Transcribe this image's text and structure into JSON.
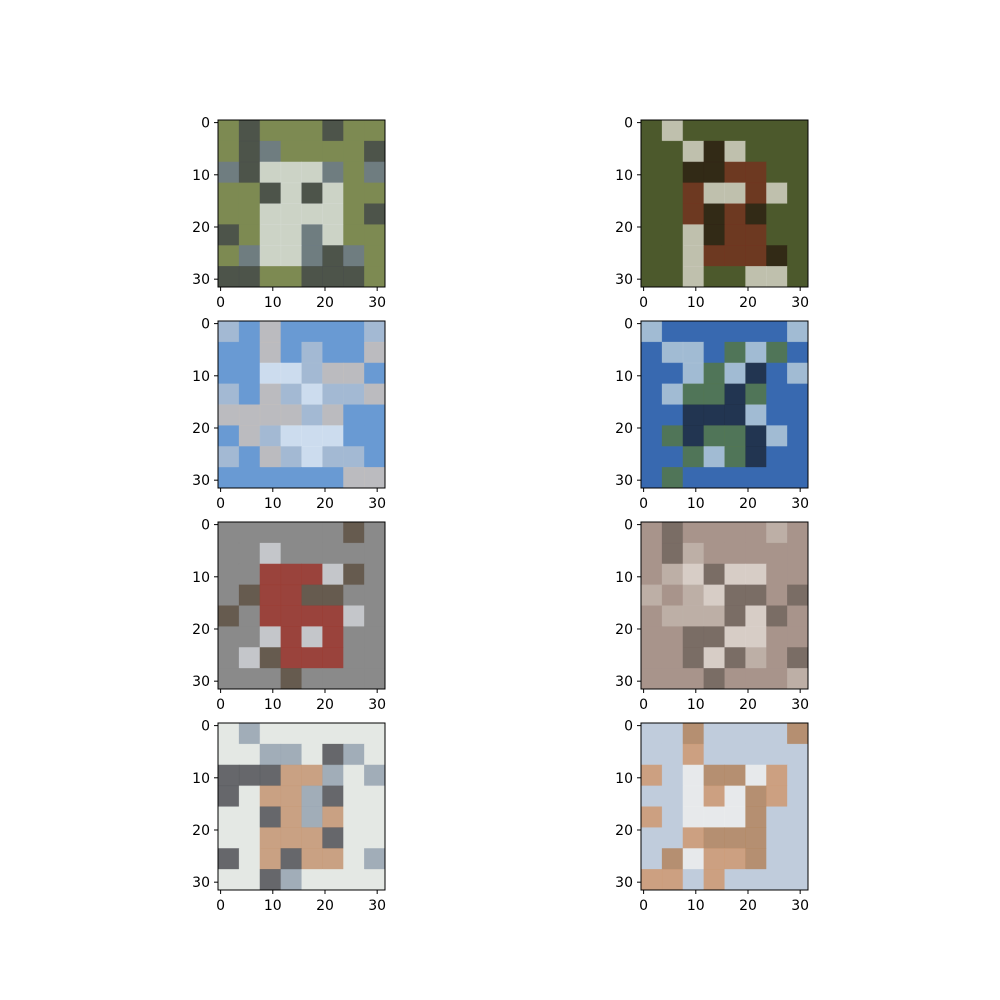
{
  "figure": {
    "subplots": [
      {
        "row": 0,
        "col": 0,
        "content": "blurry 32x32 photo: grey-white vehicle on green background",
        "colors": {
          "bg": "#7d8a52",
          "main": "#e8ecf0",
          "dark": "#3c4048",
          "accent": "#6a7890"
        }
      },
      {
        "row": 0,
        "col": 1,
        "content": "blurry 32x32 photo: brown horse/deer on green field",
        "colors": {
          "bg": "#4d5a2e",
          "main": "#7a2e1e",
          "dark": "#2a1a10",
          "accent": "#e8e4dc"
        }
      },
      {
        "row": 1,
        "col": 0,
        "content": "blurry 32x32 photo: white ship/structure against blue sky",
        "colors": {
          "bg": "#6a9ad4",
          "main": "#f0f4f8",
          "dark": "#b8c4d4",
          "accent": "#d8c8b8"
        }
      },
      {
        "row": 1,
        "col": 1,
        "content": "blurry 32x32 photo: dark animal on grass under blue sky",
        "colors": {
          "bg": "#3a6ab0",
          "main": "#1c2430",
          "dark": "#5a7a3a",
          "accent": "#c8d8e0"
        }
      },
      {
        "row": 2,
        "col": 0,
        "content": "blurry 32x32 photo: red truck beside brown horse",
        "colors": {
          "bg": "#8a8a8a",
          "main": "#a02a20",
          "dark": "#5a4a3a",
          "accent": "#d8dce0"
        }
      },
      {
        "row": 2,
        "col": 1,
        "content": "blurry 32x32 photo: pale grey boat/vehicle on brownish background",
        "colors": {
          "bg": "#a8948c",
          "main": "#e8e0dc",
          "dark": "#6a5e58",
          "accent": "#c4b8b0"
        }
      },
      {
        "row": 3,
        "col": 0,
        "content": "blurry 32x32 photo: tan horse with light background",
        "colors": {
          "bg": "#e4e8e4",
          "main": "#c08860",
          "dark": "#3a3a40",
          "accent": "#8a98a8"
        }
      },
      {
        "row": 3,
        "col": 1,
        "content": "blurry 32x32 photo: white truck on brown ground",
        "colors": {
          "bg": "#c0ccdc",
          "main": "#f4f4f0",
          "dark": "#b07a4a",
          "accent": "#d09060"
        }
      }
    ],
    "y_ticks": [
      "0",
      "10",
      "20",
      "30"
    ],
    "x_ticks": [
      "0",
      "10",
      "20",
      "30"
    ]
  }
}
